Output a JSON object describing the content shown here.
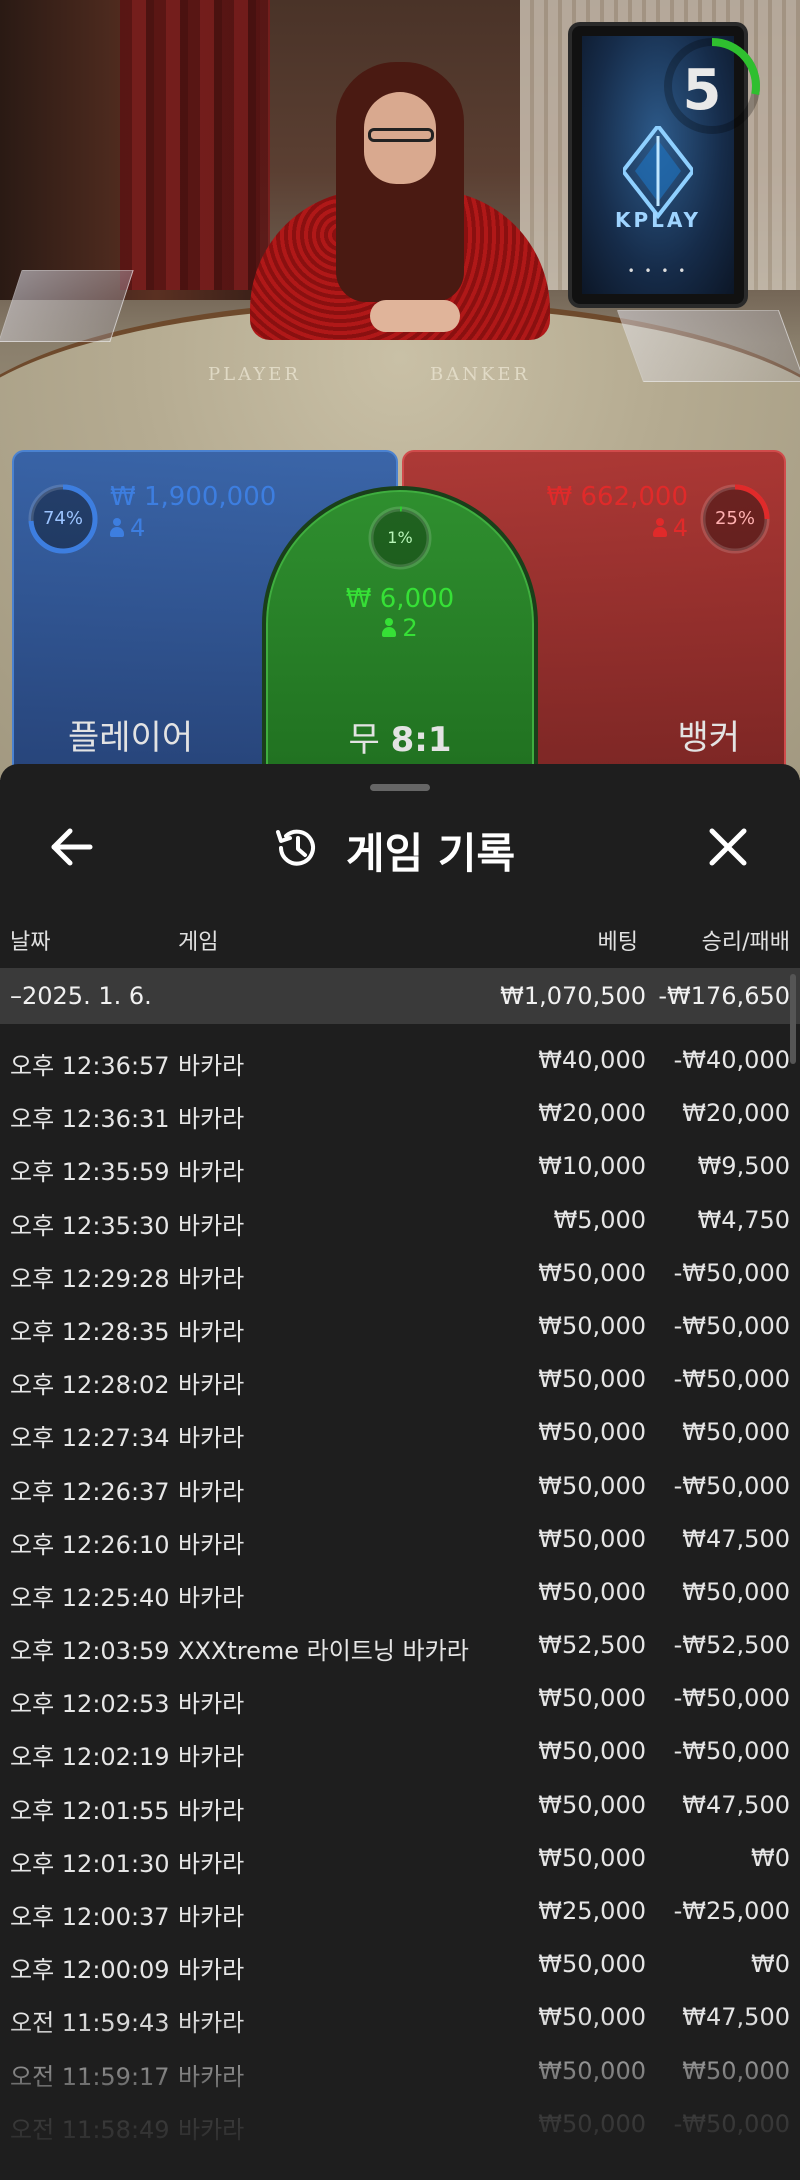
{
  "table": {
    "timer": "5",
    "brand": "KPLAY",
    "felt_player": "PLAYER",
    "felt_banker": "BANKER"
  },
  "bets": {
    "player": {
      "pct": "74%",
      "pct_value": 74,
      "amount": "₩ 1,900,000",
      "count": "4",
      "label": "플레이어",
      "color": "#3d7ee0"
    },
    "tie": {
      "pct": "1%",
      "pct_value": 1,
      "amount": "₩ 6,000",
      "count": "2",
      "label_prefix": "무",
      "label_odds": "8:1",
      "color": "#2bd12b"
    },
    "banker": {
      "pct": "25%",
      "pct_value": 25,
      "amount": "₩ 662,000",
      "count": "4",
      "label": "뱅커",
      "color": "#e02a2a"
    }
  },
  "history": {
    "title": "게임 기록",
    "back_icon": "arrow-left-icon",
    "close_icon": "close-icon",
    "title_icon": "history-icon",
    "columns": {
      "date": "날짜",
      "game": "게임",
      "bet": "베팅",
      "result": "승리/패배"
    },
    "date_group": {
      "date": "–2025. 1. 6.",
      "bet": "₩1,070,500",
      "result": "-₩176,650"
    },
    "rows": [
      {
        "time": "오후 12:36:57",
        "game": "바카라",
        "bet": "₩40,000",
        "result": "-₩40,000"
      },
      {
        "time": "오후 12:36:31",
        "game": "바카라",
        "bet": "₩20,000",
        "result": "₩20,000"
      },
      {
        "time": "오후 12:35:59",
        "game": "바카라",
        "bet": "₩10,000",
        "result": "₩9,500"
      },
      {
        "time": "오후 12:35:30",
        "game": "바카라",
        "bet": "₩5,000",
        "result": "₩4,750"
      },
      {
        "time": "오후 12:29:28",
        "game": "바카라",
        "bet": "₩50,000",
        "result": "-₩50,000"
      },
      {
        "time": "오후 12:28:35",
        "game": "바카라",
        "bet": "₩50,000",
        "result": "-₩50,000"
      },
      {
        "time": "오후 12:28:02",
        "game": "바카라",
        "bet": "₩50,000",
        "result": "-₩50,000"
      },
      {
        "time": "오후 12:27:34",
        "game": "바카라",
        "bet": "₩50,000",
        "result": "₩50,000"
      },
      {
        "time": "오후 12:26:37",
        "game": "바카라",
        "bet": "₩50,000",
        "result": "-₩50,000"
      },
      {
        "time": "오후 12:26:10",
        "game": "바카라",
        "bet": "₩50,000",
        "result": "₩47,500"
      },
      {
        "time": "오후 12:25:40",
        "game": "바카라",
        "bet": "₩50,000",
        "result": "₩50,000"
      },
      {
        "time": "오후 12:03:59",
        "game": "XXXtreme 라이트닝 바카라",
        "bet": "₩52,500",
        "result": "-₩52,500"
      },
      {
        "time": "오후 12:02:53",
        "game": "바카라",
        "bet": "₩50,000",
        "result": "-₩50,000"
      },
      {
        "time": "오후 12:02:19",
        "game": "바카라",
        "bet": "₩50,000",
        "result": "-₩50,000"
      },
      {
        "time": "오후 12:01:55",
        "game": "바카라",
        "bet": "₩50,000",
        "result": "₩47,500"
      },
      {
        "time": "오후 12:01:30",
        "game": "바카라",
        "bet": "₩50,000",
        "result": "₩0"
      },
      {
        "time": "오후 12:00:37",
        "game": "바카라",
        "bet": "₩25,000",
        "result": "-₩25,000"
      },
      {
        "time": "오후 12:00:09",
        "game": "바카라",
        "bet": "₩50,000",
        "result": "₩0"
      },
      {
        "time": "오전 11:59:43",
        "game": "바카라",
        "bet": "₩50,000",
        "result": "₩47,500"
      },
      {
        "time": "오전 11:59:17",
        "game": "바카라",
        "bet": "₩50,000",
        "result": "₩50,000"
      },
      {
        "time": "오전 11:58:49",
        "game": "바카라",
        "bet": "₩50,000",
        "result": "-₩50,000"
      }
    ]
  }
}
